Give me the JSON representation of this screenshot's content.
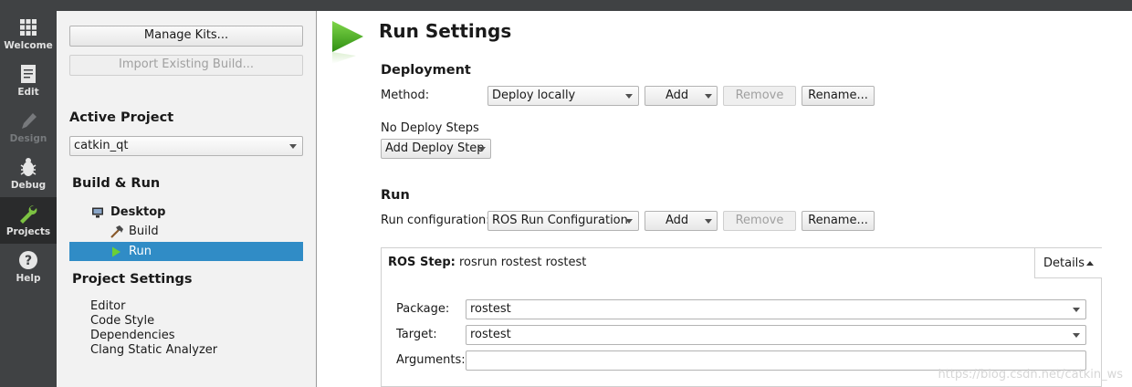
{
  "modebar": {
    "items": [
      {
        "label": "Welcome",
        "icon": "grid-icon",
        "state": "normal"
      },
      {
        "label": "Edit",
        "icon": "document-icon",
        "state": "normal"
      },
      {
        "label": "Design",
        "icon": "pencil-icon",
        "state": "disabled"
      },
      {
        "label": "Debug",
        "icon": "bug-icon",
        "state": "normal"
      },
      {
        "label": "Projects",
        "icon": "wrench-icon",
        "state": "active"
      },
      {
        "label": "Help",
        "icon": "help-icon",
        "state": "normal"
      }
    ]
  },
  "projects": {
    "manage_kits": "Manage Kits...",
    "import_build": "Import Existing Build...",
    "active_project_heading": "Active Project",
    "active_project": "catkin_qt",
    "build_run_heading": "Build & Run",
    "kit": "Desktop",
    "build": "Build",
    "run": "Run",
    "project_settings_heading": "Project Settings",
    "settings": [
      "Editor",
      "Code Style",
      "Dependencies",
      "Clang Static Analyzer"
    ]
  },
  "main": {
    "title": "Run Settings",
    "deployment": {
      "heading": "Deployment",
      "method_label": "Method:",
      "method_value": "Deploy locally",
      "add": "Add",
      "remove": "Remove",
      "rename": "Rename...",
      "no_steps": "No Deploy Steps",
      "add_step": "Add Deploy Step"
    },
    "run": {
      "heading": "Run",
      "config_label": "Run configuration:",
      "config_value": "ROS Run Configuration",
      "add": "Add",
      "remove": "Remove",
      "rename": "Rename...",
      "step_label": "ROS Step:",
      "step_cmd": "rosrun rostest rostest",
      "details": "Details",
      "package_label": "Package:",
      "package_value": "rostest",
      "target_label": "Target:",
      "target_value": "rostest",
      "arguments_label": "Arguments:",
      "arguments_value": ""
    }
  },
  "watermark": "https://blog.csdn.net/catkin_ws",
  "colors": {
    "selection": "#308cc6",
    "modebar": "#404244",
    "run_green": "#41a317"
  }
}
